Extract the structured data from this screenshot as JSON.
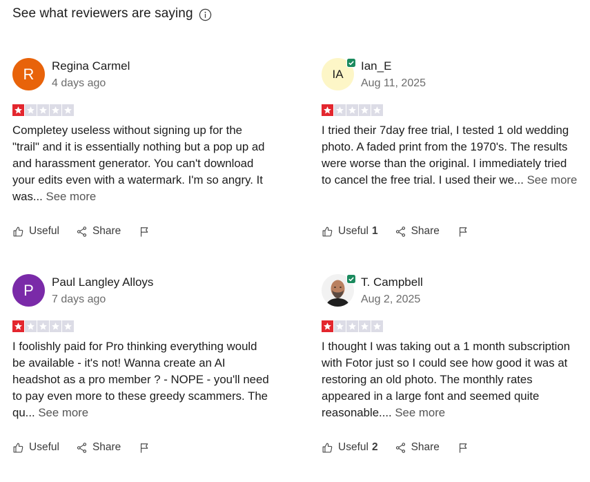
{
  "section": {
    "title": "See what reviewers are saying"
  },
  "colors": {
    "star_filled": "#e3262e",
    "star_empty": "#dcdce6",
    "verified": "#1b8a5e",
    "avatar_regina": "#e8630a",
    "avatar_ian": "#fdf6c7",
    "avatar_paul": "#7a2aa8"
  },
  "reviews": [
    {
      "name": "Regina Carmel",
      "avatar_text": "R",
      "verified": false,
      "date": "4 days ago",
      "rating": 1,
      "text": "Completey useless without signing up for the \"trail\" and it is essentially nothing but a pop up ad and harassment generator. You can't download your edits even with a watermark. I'm so angry. It was...",
      "see_more": "See more",
      "useful_label": "Useful",
      "useful_count": "",
      "share_label": "Share"
    },
    {
      "name": "Ian_E",
      "avatar_text": "IA",
      "verified": true,
      "date": "Aug 11, 2025",
      "rating": 1,
      "text": "I tried their 7day free trial, I tested 1 old wedding photo. A faded print from the 1970's. The results were worse than the original. I immediately tried to cancel the free trial. I used their we...",
      "see_more": "See more",
      "useful_label": "Useful",
      "useful_count": "1",
      "share_label": "Share"
    },
    {
      "name": "Paul Langley Alloys",
      "avatar_text": "P",
      "verified": false,
      "date": "7 days ago",
      "rating": 1,
      "text": "I foolishly paid for Pro thinking everything would be available - it's not! Wanna create an AI headshot as a pro member ? - NOPE - you'll need to pay even more to these greedy scammers. The qu...",
      "see_more": "See more",
      "useful_label": "Useful",
      "useful_count": "",
      "share_label": "Share"
    },
    {
      "name": "T. Campbell",
      "avatar_text": "",
      "verified": true,
      "date": "Aug 2, 2025",
      "rating": 1,
      "text": "I thought I was taking out a 1 month subscription with Fotor just so I could see how good it was at restoring an old photo. The monthly rates appeared in a large font and seemed quite reasonable....",
      "see_more": "See more",
      "useful_label": "Useful",
      "useful_count": "2",
      "share_label": "Share"
    }
  ]
}
